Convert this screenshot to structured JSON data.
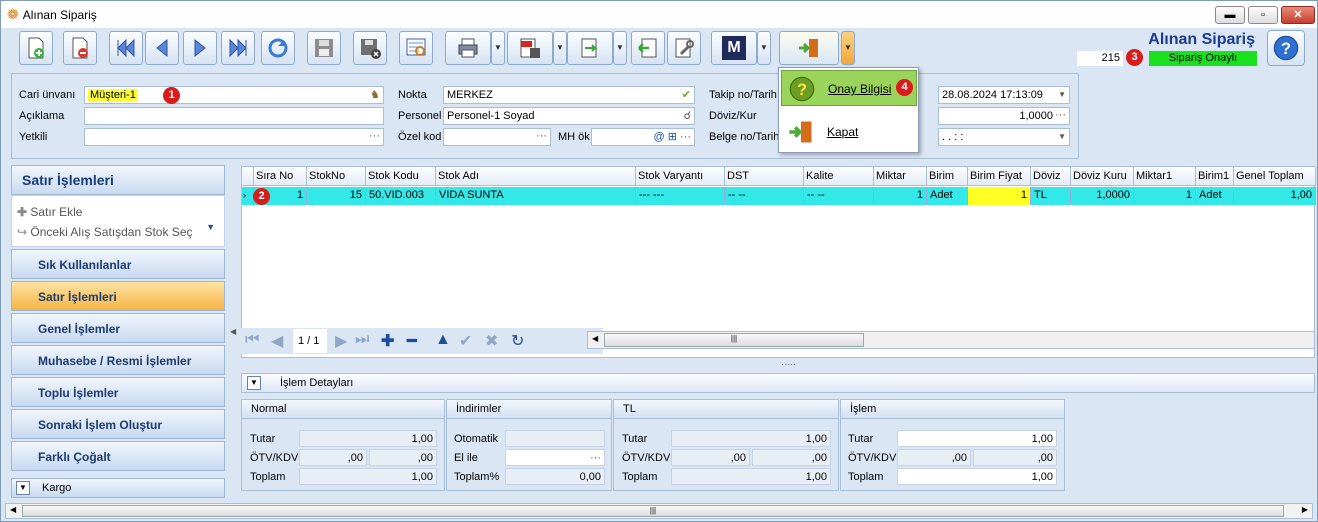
{
  "window": {
    "title": "Alınan Sipariş",
    "minimize": "▬",
    "maximize": "▫",
    "close": "✕"
  },
  "header": {
    "title": "Alınan Sipariş",
    "doc_number": "215",
    "status": "Sipariş Onaylı",
    "status_color": "#19e11e"
  },
  "toolbar": {
    "m_label": "M"
  },
  "form": {
    "cari_label": "Cari ünvanı",
    "cari_value": "Müşteri-1",
    "aciklama_label": "Açıklama",
    "aciklama_value": "",
    "yetkili_label": "Yetkili",
    "yetkili_value": "",
    "nokta_label": "Nokta",
    "nokta_value": "MERKEZ",
    "personel_label": "Personel",
    "personel_value": "Personel-1 Soyad",
    "ozel_kod_label": "Özel kod",
    "ozel_kod_value": "",
    "mh_ok_label": "MH ök",
    "mh_ok_value": "",
    "takip_label": "Takip no/Tarih",
    "takip_date": "28.08.2024 17:13:09",
    "doviz_label": "Döviz/Kur",
    "doviz_kur": "1,0000",
    "belge_label": "Belge no/Tarih",
    "belge_date": ". .   : :"
  },
  "sidebar": {
    "header": "Satır İşlemleri",
    "actions": [
      "Satır Ekle",
      "Önceki Alış Satışdan Stok Seç"
    ],
    "items": [
      "Sık Kullanılanlar",
      "Satır İşlemleri",
      "Genel İşlemler",
      "Muhasebe / Resmi İşlemler",
      "Toplu İşlemler",
      "Sonraki İşlem Oluştur",
      "Farklı Çoğalt"
    ],
    "footer": "Kargo"
  },
  "grid": {
    "columns": [
      "Sıra No",
      "StokNo",
      "Stok Kodu",
      "Stok Adı",
      "Stok Varyantı",
      "DST",
      "Kalite",
      "Miktar",
      "Birim",
      "Birim Fiyat",
      "Döviz",
      "Döviz Kuru",
      "Miktar1",
      "Birim1",
      "Genel Toplam"
    ],
    "rows": [
      [
        "1",
        "15",
        "50.VID.003",
        "VIDA SUNTA",
        "--- ---",
        "-- --",
        "-- --",
        "1",
        "Adet",
        "1",
        "TL",
        "1,0000",
        "1",
        "Adet",
        "1,00"
      ]
    ],
    "page": "1 / 1"
  },
  "details": {
    "bar_label": "İşlem Detayları",
    "normal": {
      "title": "Normal",
      "tutar_label": "Tutar",
      "tutar": "1,00",
      "otv_label": "ÖTV/KDV",
      "otv1": ",00",
      "otv2": ",00",
      "toplam_label": "Toplam",
      "toplam": "1,00"
    },
    "indirimler": {
      "title": "İndirimler",
      "otomatik_label": "Otomatik",
      "otomatik": "",
      "elile_label": "El ile",
      "elile": "",
      "toplam_pct_label": "Toplam%",
      "toplam_pct": "0,00"
    },
    "tl": {
      "title": "TL",
      "tutar_label": "Tutar",
      "tutar": "1,00",
      "otv_label": "ÖTV/KDV",
      "otv1": ",00",
      "otv2": ",00",
      "toplam_label": "Toplam",
      "toplam": "1,00"
    },
    "islem": {
      "title": "İşlem",
      "tutar_label": "Tutar",
      "tutar": "1,00",
      "otv_label": "ÖTV/KDV",
      "otv1": ",00",
      "otv2": ",00",
      "toplam_label": "Toplam",
      "toplam": "1,00"
    }
  },
  "popup": {
    "items": [
      "Onay Bilgisi",
      "Kapat"
    ]
  },
  "badges": [
    "1",
    "2",
    "3",
    "4"
  ]
}
